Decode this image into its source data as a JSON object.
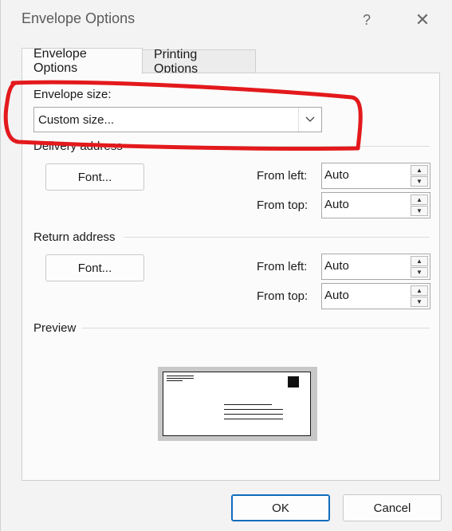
{
  "window": {
    "title": "Envelope Options",
    "help_icon": "question-mark-icon",
    "close_icon": "close-icon"
  },
  "tabs": [
    {
      "label": "Envelope Options",
      "active": true
    },
    {
      "label": "Printing Options",
      "active": false
    }
  ],
  "envelope_size": {
    "label": "Envelope size:",
    "value": "Custom size..."
  },
  "delivery_address": {
    "heading": "Delivery address",
    "font_button": "Font...",
    "from_left_label": "From left:",
    "from_left_value": "Auto",
    "from_top_label": "From top:",
    "from_top_value": "Auto"
  },
  "return_address": {
    "heading": "Return address",
    "font_button": "Font...",
    "from_left_label": "From left:",
    "from_left_value": "Auto",
    "from_top_label": "From top:",
    "from_top_value": "Auto"
  },
  "preview": {
    "heading": "Preview"
  },
  "footer": {
    "ok_label": "OK",
    "cancel_label": "Cancel"
  },
  "colors": {
    "annotation_ring": "#e3191c",
    "accent": "#0f6cbd"
  }
}
